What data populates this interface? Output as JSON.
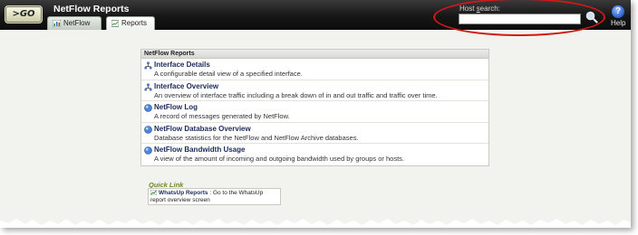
{
  "header": {
    "go_label": ">GO",
    "app_title": "NetFlow Reports",
    "tabs": [
      {
        "label": "NetFlow"
      },
      {
        "label": "Reports"
      }
    ],
    "search": {
      "label_pre": "Host ",
      "label_accel": "s",
      "label_post": "earch:",
      "value": ""
    },
    "help_label": "Help"
  },
  "panel": {
    "title": "NetFlow Reports",
    "items": [
      {
        "title": "Interface Details",
        "desc": "A configurable detail view of a specified interface.",
        "icon": "interface-icon"
      },
      {
        "title": "Interface Overview",
        "desc": "An overview of interface traffic including a break down of in and out traffic and traffic over time.",
        "icon": "interface-icon"
      },
      {
        "title": "NetFlow Log",
        "desc": "A record of messages generated by NetFlow.",
        "icon": "globe-icon"
      },
      {
        "title": "NetFlow Database Overview",
        "desc": "Database statistics for the NetFlow and NetFlow Archive databases.",
        "icon": "globe-icon"
      },
      {
        "title": "NetFlow Bandwidth Usage",
        "desc": "A view of the amount of incoming and outgoing bandwidth used by groups or hosts.",
        "icon": "globe-icon"
      }
    ]
  },
  "quick_link": {
    "title": "Quick Link",
    "link_label": "WhatsUp Reports",
    "link_desc": ": Go to the WhatsUp report overview screen"
  },
  "colors": {
    "header_bg": "#161616",
    "callout": "#d01818",
    "link_text": "#1a2a5a",
    "quick_title": "#6b8a2a"
  }
}
